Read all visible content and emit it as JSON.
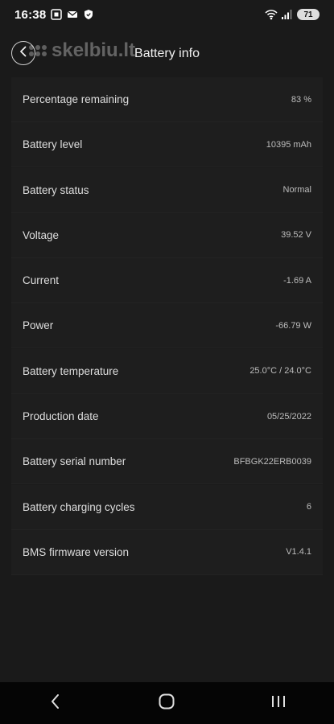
{
  "status_bar": {
    "time": "16:38",
    "battery_level": "71",
    "left_icons": [
      "screenshot-icon",
      "mail-icon",
      "shield-icon"
    ],
    "right_icons": [
      "wifi-icon",
      "signal-icon",
      "battery-icon"
    ]
  },
  "watermark": {
    "text": "skelbiu.lt"
  },
  "header": {
    "title": "Battery info",
    "back_icon": "chevron-left-icon"
  },
  "rows": [
    {
      "label": "Percentage remaining",
      "value": "83 %"
    },
    {
      "label": "Battery level",
      "value": "10395 mAh"
    },
    {
      "label": "Battery status",
      "value": "Normal"
    },
    {
      "label": "Voltage",
      "value": "39.52 V"
    },
    {
      "label": "Current",
      "value": "-1.69 A"
    },
    {
      "label": "Power",
      "value": "-66.79 W"
    },
    {
      "label": "Battery temperature",
      "value": "25.0°C / 24.0°C"
    },
    {
      "label": "Production date",
      "value": "05/25/2022"
    },
    {
      "label": "Battery serial number",
      "value": "BFBGK22ERB0039"
    },
    {
      "label": "Battery charging cycles",
      "value": "6"
    },
    {
      "label": "BMS firmware version",
      "value": "V1.4.1"
    }
  ],
  "nav_bar": {
    "icons": [
      "back-icon",
      "home-icon",
      "recents-icon"
    ]
  },
  "colors": {
    "background": "#1a1a1a",
    "row_background": "#1e1e1e",
    "nav_background": "#050505"
  }
}
